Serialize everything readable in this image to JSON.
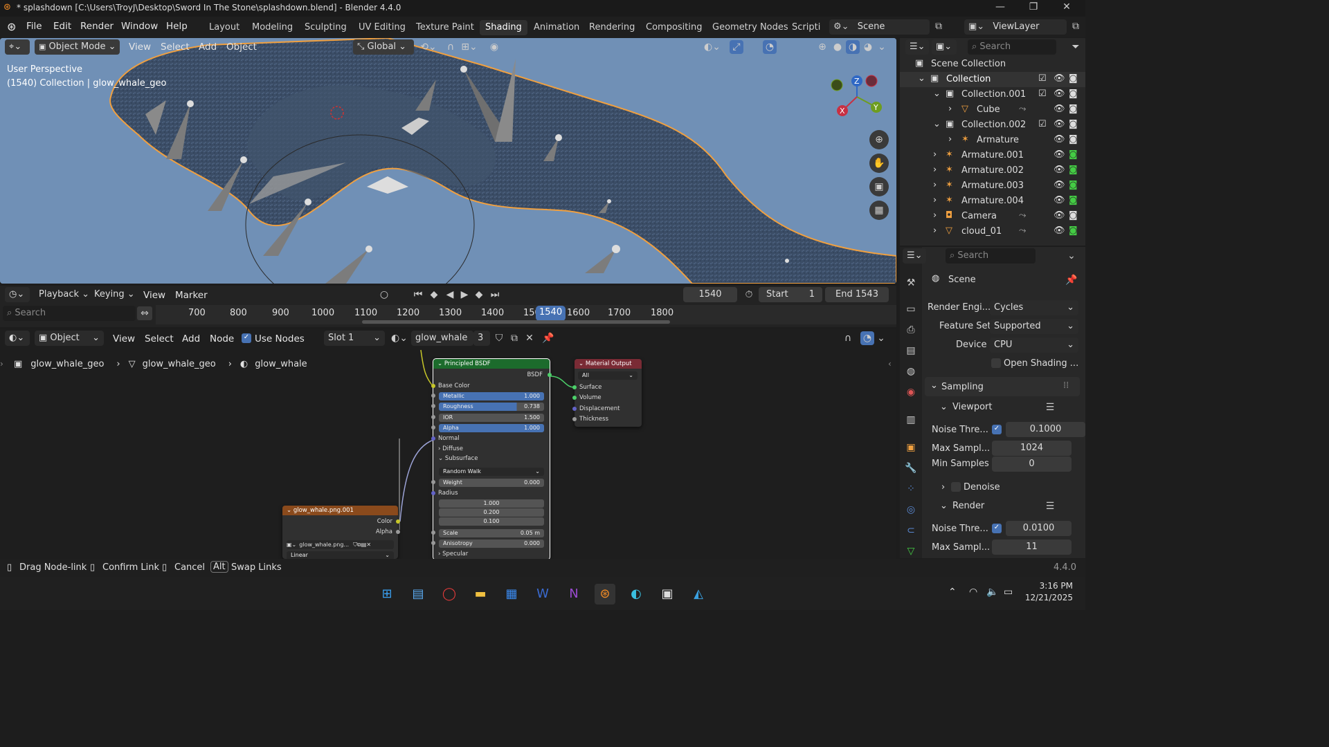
{
  "window": {
    "title": "* splashdown [C:\\Users\\TroyJ\\Desktop\\Sword In The Stone\\splashdown.blend] - Blender 4.4.0"
  },
  "menu": [
    "File",
    "Edit",
    "Render",
    "Window",
    "Help"
  ],
  "workspaces": [
    "Layout",
    "Modeling",
    "Sculpting",
    "UV Editing",
    "Texture Paint",
    "Shading",
    "Animation",
    "Rendering",
    "Compositing",
    "Geometry Nodes",
    "Scripti"
  ],
  "scene": "Scene",
  "view_layer": "ViewLayer",
  "viewport": {
    "mode": "Object Mode",
    "menus": [
      "View",
      "Select",
      "Add",
      "Object"
    ],
    "transform": "Global",
    "overlay_line1": "User Perspective",
    "overlay_line2": "(1540) Collection | glow_whale_geo"
  },
  "outliner": {
    "search": "Search",
    "items": [
      {
        "name": "Scene Collection"
      },
      {
        "name": "Collection"
      },
      {
        "name": "Collection.001"
      },
      {
        "name": "Cube"
      },
      {
        "name": "Collection.002"
      },
      {
        "name": "Armature"
      },
      {
        "name": "Armature.001"
      },
      {
        "name": "Armature.002"
      },
      {
        "name": "Armature.003"
      },
      {
        "name": "Armature.004"
      },
      {
        "name": "Camera"
      },
      {
        "name": "cloud_01"
      }
    ]
  },
  "timeline": {
    "menus": [
      "Playback",
      "Keying",
      "View",
      "Marker"
    ],
    "current": "1540",
    "start_label": "Start",
    "start": "1",
    "end_label": "End",
    "end": "1543",
    "search": "Search",
    "ticks": [
      "700",
      "800",
      "900",
      "1000",
      "1100",
      "1200",
      "1300",
      "1400",
      "150",
      "1540",
      "1600",
      "1700",
      "1800"
    ]
  },
  "node_editor": {
    "type": "Object",
    "menus": [
      "View",
      "Select",
      "Add",
      "Node"
    ],
    "use_nodes": "Use Nodes",
    "slot": "Slot 1",
    "material": "glow_whale",
    "users": "3",
    "breadcrumb": [
      "glow_whale_geo",
      "glow_whale_geo",
      "glow_whale"
    ]
  },
  "bsdf": {
    "title": "Principled BSDF",
    "out": "BSDF",
    "base": "Base Color",
    "fields": [
      {
        "l": "Metallic",
        "v": "1.000"
      },
      {
        "l": "Roughness",
        "v": "0.738"
      },
      {
        "l": "IOR",
        "v": "1.500"
      },
      {
        "l": "Alpha",
        "v": "1.000"
      }
    ],
    "normal": "Normal",
    "diffuse": "Diffuse",
    "subsurface": "Subsurface",
    "method": "Random Walk",
    "weight_l": "Weight",
    "weight_v": "0.000",
    "radius": "Radius",
    "radius_vals": [
      "1.000",
      "0.200",
      "0.100"
    ],
    "scale_l": "Scale",
    "scale_v": "0.05 m",
    "aniso_l": "Anisotropy",
    "aniso_v": "0.000",
    "specular": "Specular"
  },
  "matout": {
    "title": "Material Output",
    "target": "All",
    "inputs": [
      "Surface",
      "Volume",
      "Displacement",
      "Thickness"
    ]
  },
  "imgnode": {
    "title": "glow_whale.png.001",
    "outputs": [
      "Color",
      "Alpha"
    ],
    "image": "glow_whale.png...",
    "interp": "Linear"
  },
  "properties": {
    "search": "Search",
    "scene": "Scene",
    "engine_l": "Render Engi...",
    "engine": "Cycles",
    "feature_l": "Feature Set",
    "feature": "Supported",
    "device_l": "Device",
    "device": "CPU",
    "osl": "Open Shading ...",
    "sampling": "Sampling",
    "viewport": "Viewport",
    "noise_l": "Noise Thre...",
    "noise_v": "0.1000",
    "max_l": "Max Sampl...",
    "max_v": "1024",
    "min_l": "Min Samples",
    "min_v": "0",
    "denoise": "Denoise",
    "render": "Render",
    "rnoise_v": "0.0100",
    "rmax_v": "11"
  },
  "status": {
    "items": [
      "Drag Node-link",
      "Confirm Link",
      "Cancel",
      "Alt",
      "Swap Links"
    ],
    "version": "4.4.0"
  },
  "taskbar": {
    "time": "3:16 PM",
    "date": "12/21/2025"
  },
  "colors": {
    "accent": "#4772b3",
    "selection_outline": "#f0a040",
    "bsdf_header": "#1c6b2c",
    "output_header": "#7a2b35",
    "image_header": "#8a4a1c"
  }
}
